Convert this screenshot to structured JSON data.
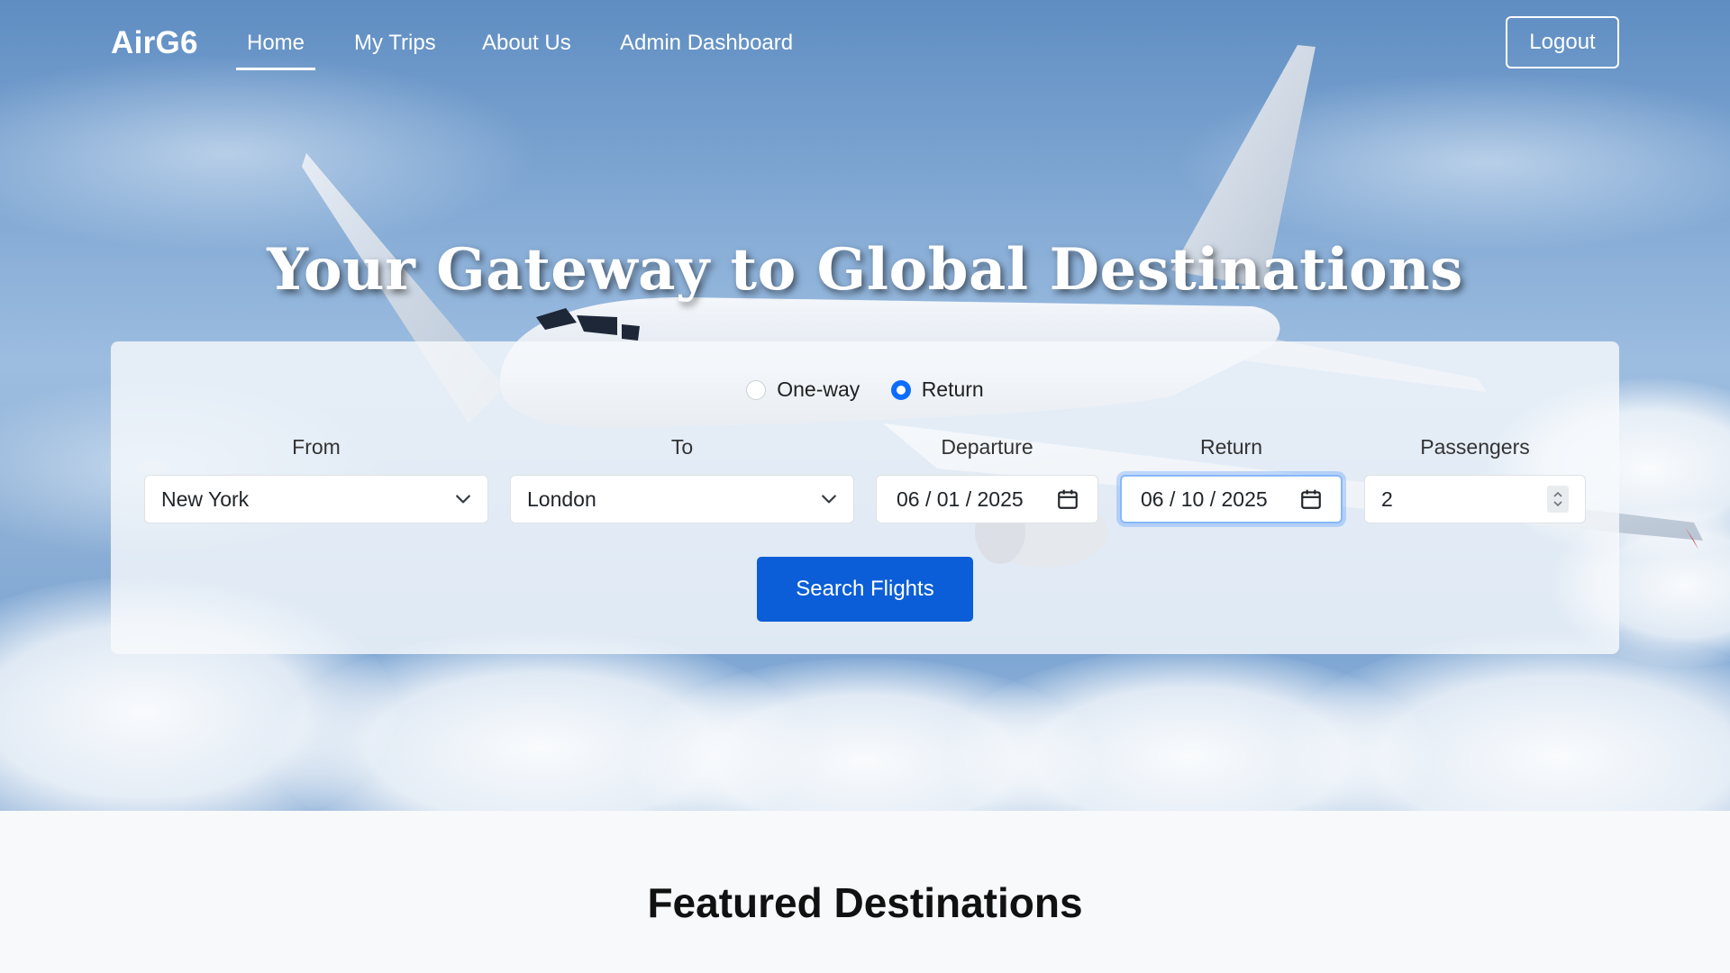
{
  "nav": {
    "brand": "AirG6",
    "links": [
      {
        "label": "Home",
        "active": true
      },
      {
        "label": "My Trips",
        "active": false
      },
      {
        "label": "About Us",
        "active": false
      },
      {
        "label": "Admin Dashboard",
        "active": false
      }
    ],
    "logout_label": "Logout"
  },
  "hero": {
    "title": "Your Gateway to Global Destinations"
  },
  "search": {
    "trip_types": [
      {
        "label": "One-way",
        "checked": false
      },
      {
        "label": "Return",
        "checked": true
      }
    ],
    "from": {
      "label": "From",
      "value": "New York"
    },
    "to": {
      "label": "To",
      "value": "London"
    },
    "departure": {
      "label": "Departure",
      "value": "06 / 01 / 2025"
    },
    "return": {
      "label": "Return",
      "value": "06 / 10 / 2025"
    },
    "passengers": {
      "label": "Passengers",
      "value": "2"
    },
    "button_label": "Search Flights"
  },
  "featured": {
    "title": "Featured Destinations"
  },
  "colors": {
    "primary": "#0b5ed7",
    "radio_checked": "#0d6efd",
    "focus_ring": "#86b7fe"
  }
}
